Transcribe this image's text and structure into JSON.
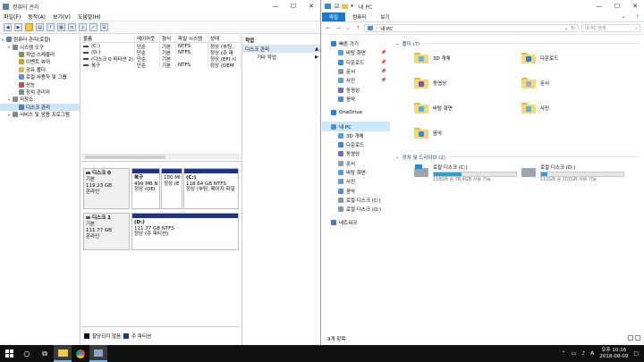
{
  "left_window": {
    "title": "컴퓨터 관리",
    "controls": [
      "—",
      "☐",
      "✕"
    ],
    "menu": [
      "파일(F)",
      "동작(A)",
      "보기(V)",
      "도움말(H)"
    ],
    "tree": [
      {
        "label": "컴퓨터 관리(로컬)",
        "indent": 0,
        "color": "#5b7fa8"
      },
      {
        "label": "시스템 도구",
        "indent": 1,
        "color": "#7a8a99"
      },
      {
        "label": "작업 스케줄러",
        "indent": 2,
        "color": "#7a9a5a"
      },
      {
        "label": "이벤트 뷰어",
        "indent": 2,
        "color": "#c8a040"
      },
      {
        "label": "공유 폴더",
        "indent": 2,
        "color": "#e0b850"
      },
      {
        "label": "로컬 사용자 및 그룹",
        "indent": 2,
        "color": "#6a8fc8"
      },
      {
        "label": "성능",
        "indent": 2,
        "color": "#c05050"
      },
      {
        "label": "장치 관리자",
        "indent": 2,
        "color": "#7a8a99"
      },
      {
        "label": "저장소",
        "indent": 1,
        "color": "#8a8a8a"
      },
      {
        "label": "디스크 관리",
        "indent": 2,
        "color": "#5a7aa8",
        "selected": true
      },
      {
        "label": "서비스 및 응용 프로그램",
        "indent": 1,
        "color": "#7a8a99"
      }
    ],
    "volume_columns": [
      "볼륨",
      "레이아웃",
      "형식",
      "파일 시스템",
      "상태"
    ],
    "volumes": [
      [
        "(C:)",
        "단순",
        "기본",
        "NTFS",
        "정상 (부팅,"
      ],
      [
        "(D:)",
        "단순",
        "기본",
        "NTFS",
        "정상 (주 파"
      ],
      [
        "(디스크 0 파티션 2)",
        "단순",
        "기본",
        "",
        "정상 (EFI 시"
      ],
      [
        "복구",
        "단순",
        "기본",
        "NTFS",
        "정상 (OEM"
      ]
    ],
    "disks": [
      {
        "name": "디스크 0",
        "type": "기본",
        "size": "119.23 GB",
        "status": "온라인",
        "partitions": [
          {
            "title": "복구",
            "line1": "499 MB N",
            "line2": "정상 (OEI"
          },
          {
            "title": "",
            "line1": "100 MI",
            "line2": "정상 (E"
          },
          {
            "title": "(C:)",
            "line1": "118.64 GB NTFS",
            "line2": "정상 (부팅, 페이지 파일"
          }
        ]
      },
      {
        "name": "디스크 1",
        "type": "기본",
        "size": "111.77 GB",
        "status": "온라인",
        "partitions": [
          {
            "title": "(D:)",
            "line1": "111.77 GB NTFS",
            "line2": "정상 (주 파티션)"
          }
        ]
      }
    ],
    "legend": [
      {
        "label": "할당되지 않음",
        "color": "#111111"
      },
      {
        "label": "주 파티션",
        "color": "#1c3486"
      }
    ],
    "actions": {
      "header": "작업",
      "section": "디스크 관리",
      "item": "기타 작업"
    }
  },
  "right_window": {
    "title": "내 PC",
    "controls": [
      "—",
      "☐",
      "✕"
    ],
    "ribbon_tabs": [
      "파일",
      "컴퓨터",
      "보기"
    ],
    "address": "내 PC",
    "search_placeholder": "내 PC 검색",
    "nav": [
      {
        "label": "빠른 가기",
        "level": "top",
        "color": "#2b7fd6"
      },
      {
        "label": "바탕 화면",
        "level": "l2",
        "color": "#4aa0e0",
        "pin": "📌"
      },
      {
        "label": "다운로드",
        "level": "l2",
        "color": "#3b8ad6",
        "pin": "📌"
      },
      {
        "label": "문서",
        "level": "l2",
        "color": "#8a9ab0",
        "pin": "📌"
      },
      {
        "label": "사진",
        "level": "l2",
        "color": "#5aa0d0",
        "pin": "📌"
      },
      {
        "label": "동영상",
        "level": "l2",
        "color": "#7a6ab0"
      },
      {
        "label": "음악",
        "level": "l2",
        "color": "#4a90d0"
      },
      {
        "label": "",
        "level": "gap"
      },
      {
        "label": "OneDrive",
        "level": "top",
        "color": "#2b7fd6"
      },
      {
        "label": "",
        "level": "gap"
      },
      {
        "label": "내 PC",
        "level": "top",
        "color": "#4a90d0",
        "selected": true
      },
      {
        "label": "3D 개체",
        "level": "l2",
        "color": "#4aa0e0"
      },
      {
        "label": "다운로드",
        "level": "l2",
        "color": "#3b8ad6"
      },
      {
        "label": "동영상",
        "level": "l2",
        "color": "#7a6ab0"
      },
      {
        "label": "문서",
        "level": "l2",
        "color": "#8a9ab0"
      },
      {
        "label": "바탕 화면",
        "level": "l2",
        "color": "#4aa0e0"
      },
      {
        "label": "사진",
        "level": "l2",
        "color": "#5aa0d0"
      },
      {
        "label": "음악",
        "level": "l2",
        "color": "#4a90d0"
      },
      {
        "label": "로컬 디스크 (C:)",
        "level": "l2",
        "color": "#8a95a0"
      },
      {
        "label": "로컬 디스크 (D:)",
        "level": "l2",
        "color": "#8a95a0"
      },
      {
        "label": "",
        "level": "gap"
      },
      {
        "label": "네트워크",
        "level": "top",
        "color": "#4a7ab0"
      }
    ],
    "folders_group": "폴더 (7)",
    "folders": [
      {
        "label": "3D 개체",
        "glyph": "#57b6e8"
      },
      {
        "label": "다운로드",
        "glyph": "#2f7fd4"
      },
      {
        "label": "동영상",
        "glyph": "#6a5aa8"
      },
      {
        "label": "문서",
        "glyph": "#9ab0c8"
      },
      {
        "label": "바탕 화면",
        "glyph": "#4ab0e8"
      },
      {
        "label": "사진",
        "glyph": "#5ab0d8"
      },
      {
        "label": "음악",
        "glyph": "#3a8ad8"
      }
    ],
    "drives_group": "장치 및 드라이브 (2)",
    "drives": [
      {
        "name": "로컬 디스크 (C:)",
        "free": "118GB 중 78.4GB 사용 가능",
        "used_fraction": 0.34
      },
      {
        "name": "로컬 디스크 (D:)",
        "free": "111GB 중 102GB 사용 가능",
        "used_fraction": 0.08
      }
    ],
    "status": "9개 항목"
  },
  "taskbar": {
    "search_glyph": "○",
    "task_glyph": "⧉",
    "clock_time": "오후 10:16",
    "clock_date": "2018-08-09",
    "ime": "A"
  }
}
